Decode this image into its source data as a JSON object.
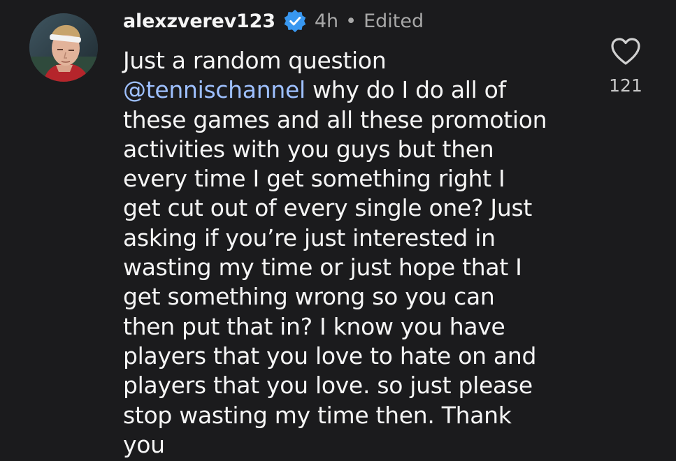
{
  "comment": {
    "username": "alexzverev123",
    "time": "4h",
    "separator": "•",
    "edited": "Edited",
    "lines": [
      {
        "mention": "",
        "text": "Just a random question"
      },
      {
        "mention": "@tennischannel",
        "text": " why do I do all of"
      },
      {
        "mention": "",
        "text": "these games and all these promotion"
      },
      {
        "mention": "",
        "text": "activities with you guys but then"
      },
      {
        "mention": "",
        "text": "every time I get something right I"
      },
      {
        "mention": "",
        "text": "get cut out of every single one? Just"
      },
      {
        "mention": "",
        "text": "asking if you’re just interested in"
      },
      {
        "mention": "",
        "text": "wasting my time or just hope that I"
      },
      {
        "mention": "",
        "text": "get something wrong so you can"
      },
      {
        "mention": "",
        "text": "then put that in? I know you have"
      },
      {
        "mention": "",
        "text": "players that you love to hate on and"
      },
      {
        "mention": "",
        "text": "players that you love. so just please"
      },
      {
        "mention": "",
        "text": "stop wasting my time then. Thank"
      },
      {
        "mention": "",
        "text": "you"
      }
    ],
    "like_count": "121"
  },
  "icons": {
    "avatar": "profile-photo",
    "verified": "verified-badge-icon",
    "like": "heart-outline-icon"
  },
  "colors": {
    "background": "#1b1b1d",
    "text": "#f5f5f5",
    "meta": "#a8a8a8",
    "mention": "#9ec0ff",
    "verified": "#3897f0"
  }
}
